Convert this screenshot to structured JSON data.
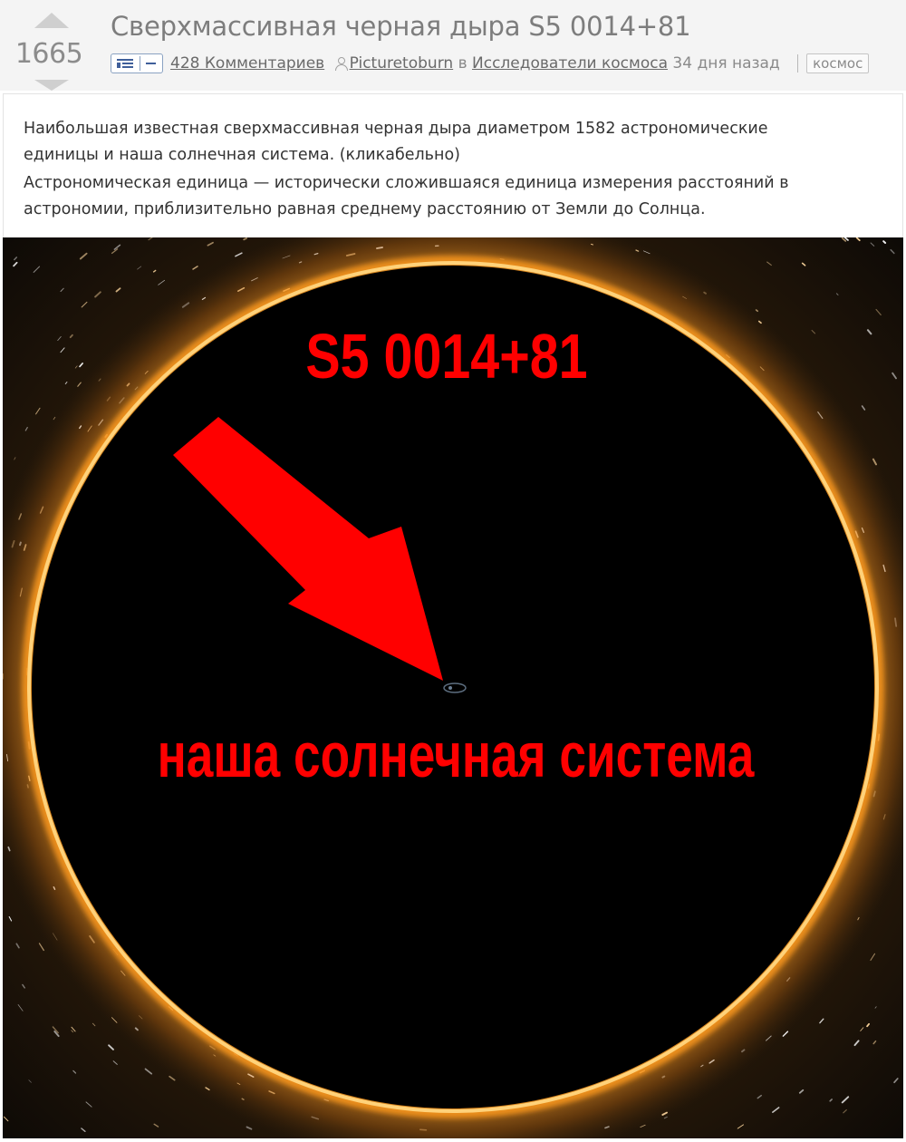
{
  "post": {
    "rating": "1665",
    "title": "Сверхмассивная черная дыра S5 0014+81",
    "comments_link": "428 Комментариев",
    "author": "Picturetoburn",
    "in_word": "в",
    "community": "Исследователи космоса",
    "time_ago": "34 дня назад",
    "tag": "космос"
  },
  "description": {
    "lines": [
      "Наибольшая известная сверхмассивная черная дыра диаметром 1582 астрономические",
      "единицы и наша солнечная система. (кликабельно)",
      "Астрономическая единица — исторически сложившаяся единица измерения расстояний в",
      "астрономии, приблизительно равная среднему расстоянию от Земли до Солнца."
    ]
  },
  "image": {
    "label_black_hole": "S5 0014+81",
    "label_solar_system": "наша солнечная система",
    "annotation_color": "#ff0000",
    "ring_color": "#ff9a1c",
    "icons": [
      "vote-up-icon",
      "vote-down-icon",
      "expand-toggle-icon",
      "user-icon",
      "arrow-icon"
    ]
  }
}
